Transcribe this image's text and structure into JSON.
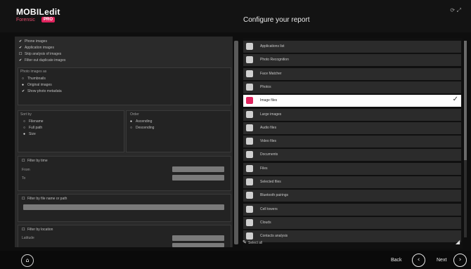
{
  "header": {
    "logo_text": "MOBILedit",
    "logo_sub": "Forensic",
    "logo_badge": "PRO",
    "logo_extra": "",
    "title": "Configure your report",
    "window_icons": "⟳ ⤢"
  },
  "left_panel": {
    "options": [
      {
        "label": "Phone images",
        "checked": true
      },
      {
        "label": "Application images",
        "checked": true
      },
      {
        "label": "Skip analysis of images",
        "checked": false
      },
      {
        "label": "Filter out duplicate images",
        "checked": true
      }
    ],
    "photo_images_as": {
      "title": "Photo images as",
      "options": [
        {
          "label": "Thumbnails",
          "checked": false
        },
        {
          "label": "Original images",
          "checked": true
        },
        {
          "label": "Show photo metadata",
          "checked": true
        }
      ]
    },
    "sort_by": {
      "title": "Sort by",
      "options": [
        {
          "label": "Filename",
          "checked": false
        },
        {
          "label": "Full path",
          "checked": false
        },
        {
          "label": "Size",
          "checked": true
        }
      ]
    },
    "order": {
      "title": "Order",
      "options": [
        {
          "label": "Ascending",
          "checked": true
        },
        {
          "label": "Descending",
          "checked": false
        }
      ]
    },
    "filter_by_time": {
      "label": "Filter by time",
      "from_label": "From",
      "to_label": "To"
    },
    "filter_by_name": {
      "label": "Filter by file name or path"
    },
    "filter_by_location": {
      "label": "Filter by location",
      "sub_label": "Latitude"
    }
  },
  "report_items": [
    {
      "label": "Applications list",
      "icon": "document-icon",
      "color": "#d0d0d0",
      "selected": false
    },
    {
      "label": "Photo Recognition",
      "icon": "camera-icon",
      "color": "#d0d0d0",
      "selected": false
    },
    {
      "label": "Face Matcher",
      "icon": "face-icon",
      "color": "#d0d0d0",
      "selected": false
    },
    {
      "label": "Photos",
      "icon": "camera-icon",
      "color": "#d0d0d0",
      "selected": false
    },
    {
      "label": "Image files",
      "icon": "image-icon",
      "color": "#e0245e",
      "selected": true
    },
    {
      "label": "Large images",
      "icon": "monitor-icon",
      "color": "#d0d0d0",
      "selected": false
    },
    {
      "label": "Audio files",
      "icon": "music-icon",
      "color": "#d0d0d0",
      "selected": false
    },
    {
      "label": "Video files",
      "icon": "video-icon",
      "color": "#d0d0d0",
      "selected": false
    },
    {
      "label": "Documents",
      "icon": "document-icon",
      "color": "#d0d0d0",
      "selected": false
    },
    {
      "label": "Files",
      "icon": "folder-icon",
      "color": "#d0d0d0",
      "selected": false
    },
    {
      "label": "Selected files",
      "icon": "folder-icon",
      "color": "#d0d0d0",
      "selected": false
    },
    {
      "label": "Bluetooth pairings",
      "icon": "bluetooth-icon",
      "color": "#d0d0d0",
      "selected": false
    },
    {
      "label": "Cell towers",
      "icon": "antenna-icon",
      "color": "#d0d0d0",
      "selected": false
    },
    {
      "label": "Clouds",
      "icon": "cloud-icon",
      "color": "#d0d0d0",
      "selected": false
    },
    {
      "label": "Contacts analysis",
      "icon": "people-icon",
      "color": "#d0d0d0",
      "selected": false
    }
  ],
  "footer": {
    "select_all": "Select all",
    "expand_label": "",
    "back": "Back",
    "next": "Next"
  }
}
